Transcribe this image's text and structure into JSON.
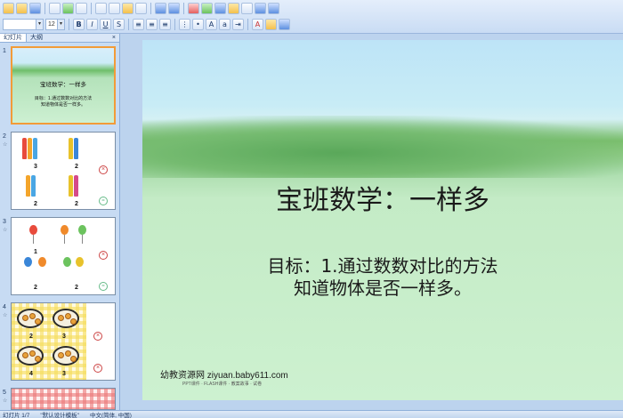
{
  "toolbar": {
    "font_name": "",
    "font_size": "12",
    "bold": "B",
    "italic": "I",
    "underline": "U",
    "strike": "S",
    "shadow": "A",
    "font_color": "A"
  },
  "panel": {
    "tab_slides": "幻灯片",
    "tab_outline": "大纲",
    "close": "×"
  },
  "thumbnails": [
    {
      "num": "1",
      "title": "宝班数学：一样多",
      "body_line1": "目标：1.通过数数对比的方法",
      "body_line2": "知道物体是否一样多。"
    },
    {
      "num": "2",
      "star": "☆",
      "counts": [
        "3",
        "2",
        "2",
        "2"
      ]
    },
    {
      "num": "3",
      "star": "☆",
      "counts": [
        "1",
        "2",
        "2",
        "2"
      ]
    },
    {
      "num": "4",
      "star": "☆",
      "counts": [
        "2",
        "3",
        "4",
        "3"
      ]
    },
    {
      "num": "5",
      "star": "☆"
    }
  ],
  "slide": {
    "title": "宝班数学：一样多",
    "body_line1": "目标：1.通过数数对比的方法",
    "body_line2": "知道物体是否一样多。",
    "watermark": "幼教资源网 ziyuan.baby611.com",
    "watermark_sub": "PPT课件 · FLASH课件 · 教案故事 · 试卷"
  },
  "status": {
    "slide_info": "幻灯片 1/7",
    "theme": "\"默认设计模板\"",
    "language": "中文(简体, 中国)"
  },
  "colors": {
    "selected_border": "#f29b38",
    "toolbar_bg": "#c9dcf4"
  }
}
